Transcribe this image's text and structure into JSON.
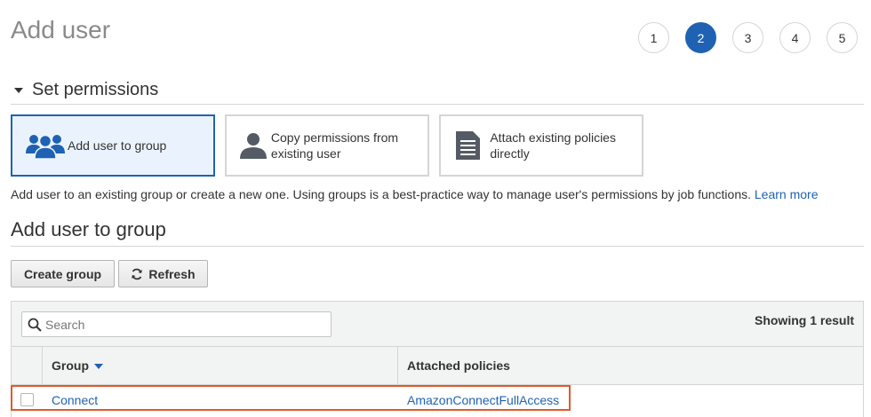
{
  "page": {
    "title": "Add user"
  },
  "steps": [
    "1",
    "2",
    "3",
    "4",
    "5"
  ],
  "active_step": "2",
  "section": {
    "title": "Set permissions"
  },
  "options": [
    {
      "label": "Add user to group",
      "icon": "group-icon",
      "selected": true
    },
    {
      "label": "Copy permissions from existing user",
      "icon": "user-icon",
      "selected": false
    },
    {
      "label": "Attach existing policies directly",
      "icon": "document-icon",
      "selected": false
    }
  ],
  "description": {
    "text": "Add user to an existing group or create a new one. Using groups is a best-practice way to manage user's permissions by job functions.",
    "link": "Learn more"
  },
  "subsection": {
    "title": "Add user to group"
  },
  "buttons": {
    "create_group": "Create group",
    "refresh": "Refresh"
  },
  "table": {
    "search_placeholder": "Search",
    "result_count": "Showing 1 result",
    "columns": {
      "group": "Group",
      "policies": "Attached policies"
    },
    "rows": [
      {
        "group": "Connect",
        "policies": "AmazonConnectFullAccess"
      }
    ]
  },
  "colors": {
    "accent": "#1f62b3",
    "highlight": "#e05a2b",
    "icon": "#545b64"
  }
}
